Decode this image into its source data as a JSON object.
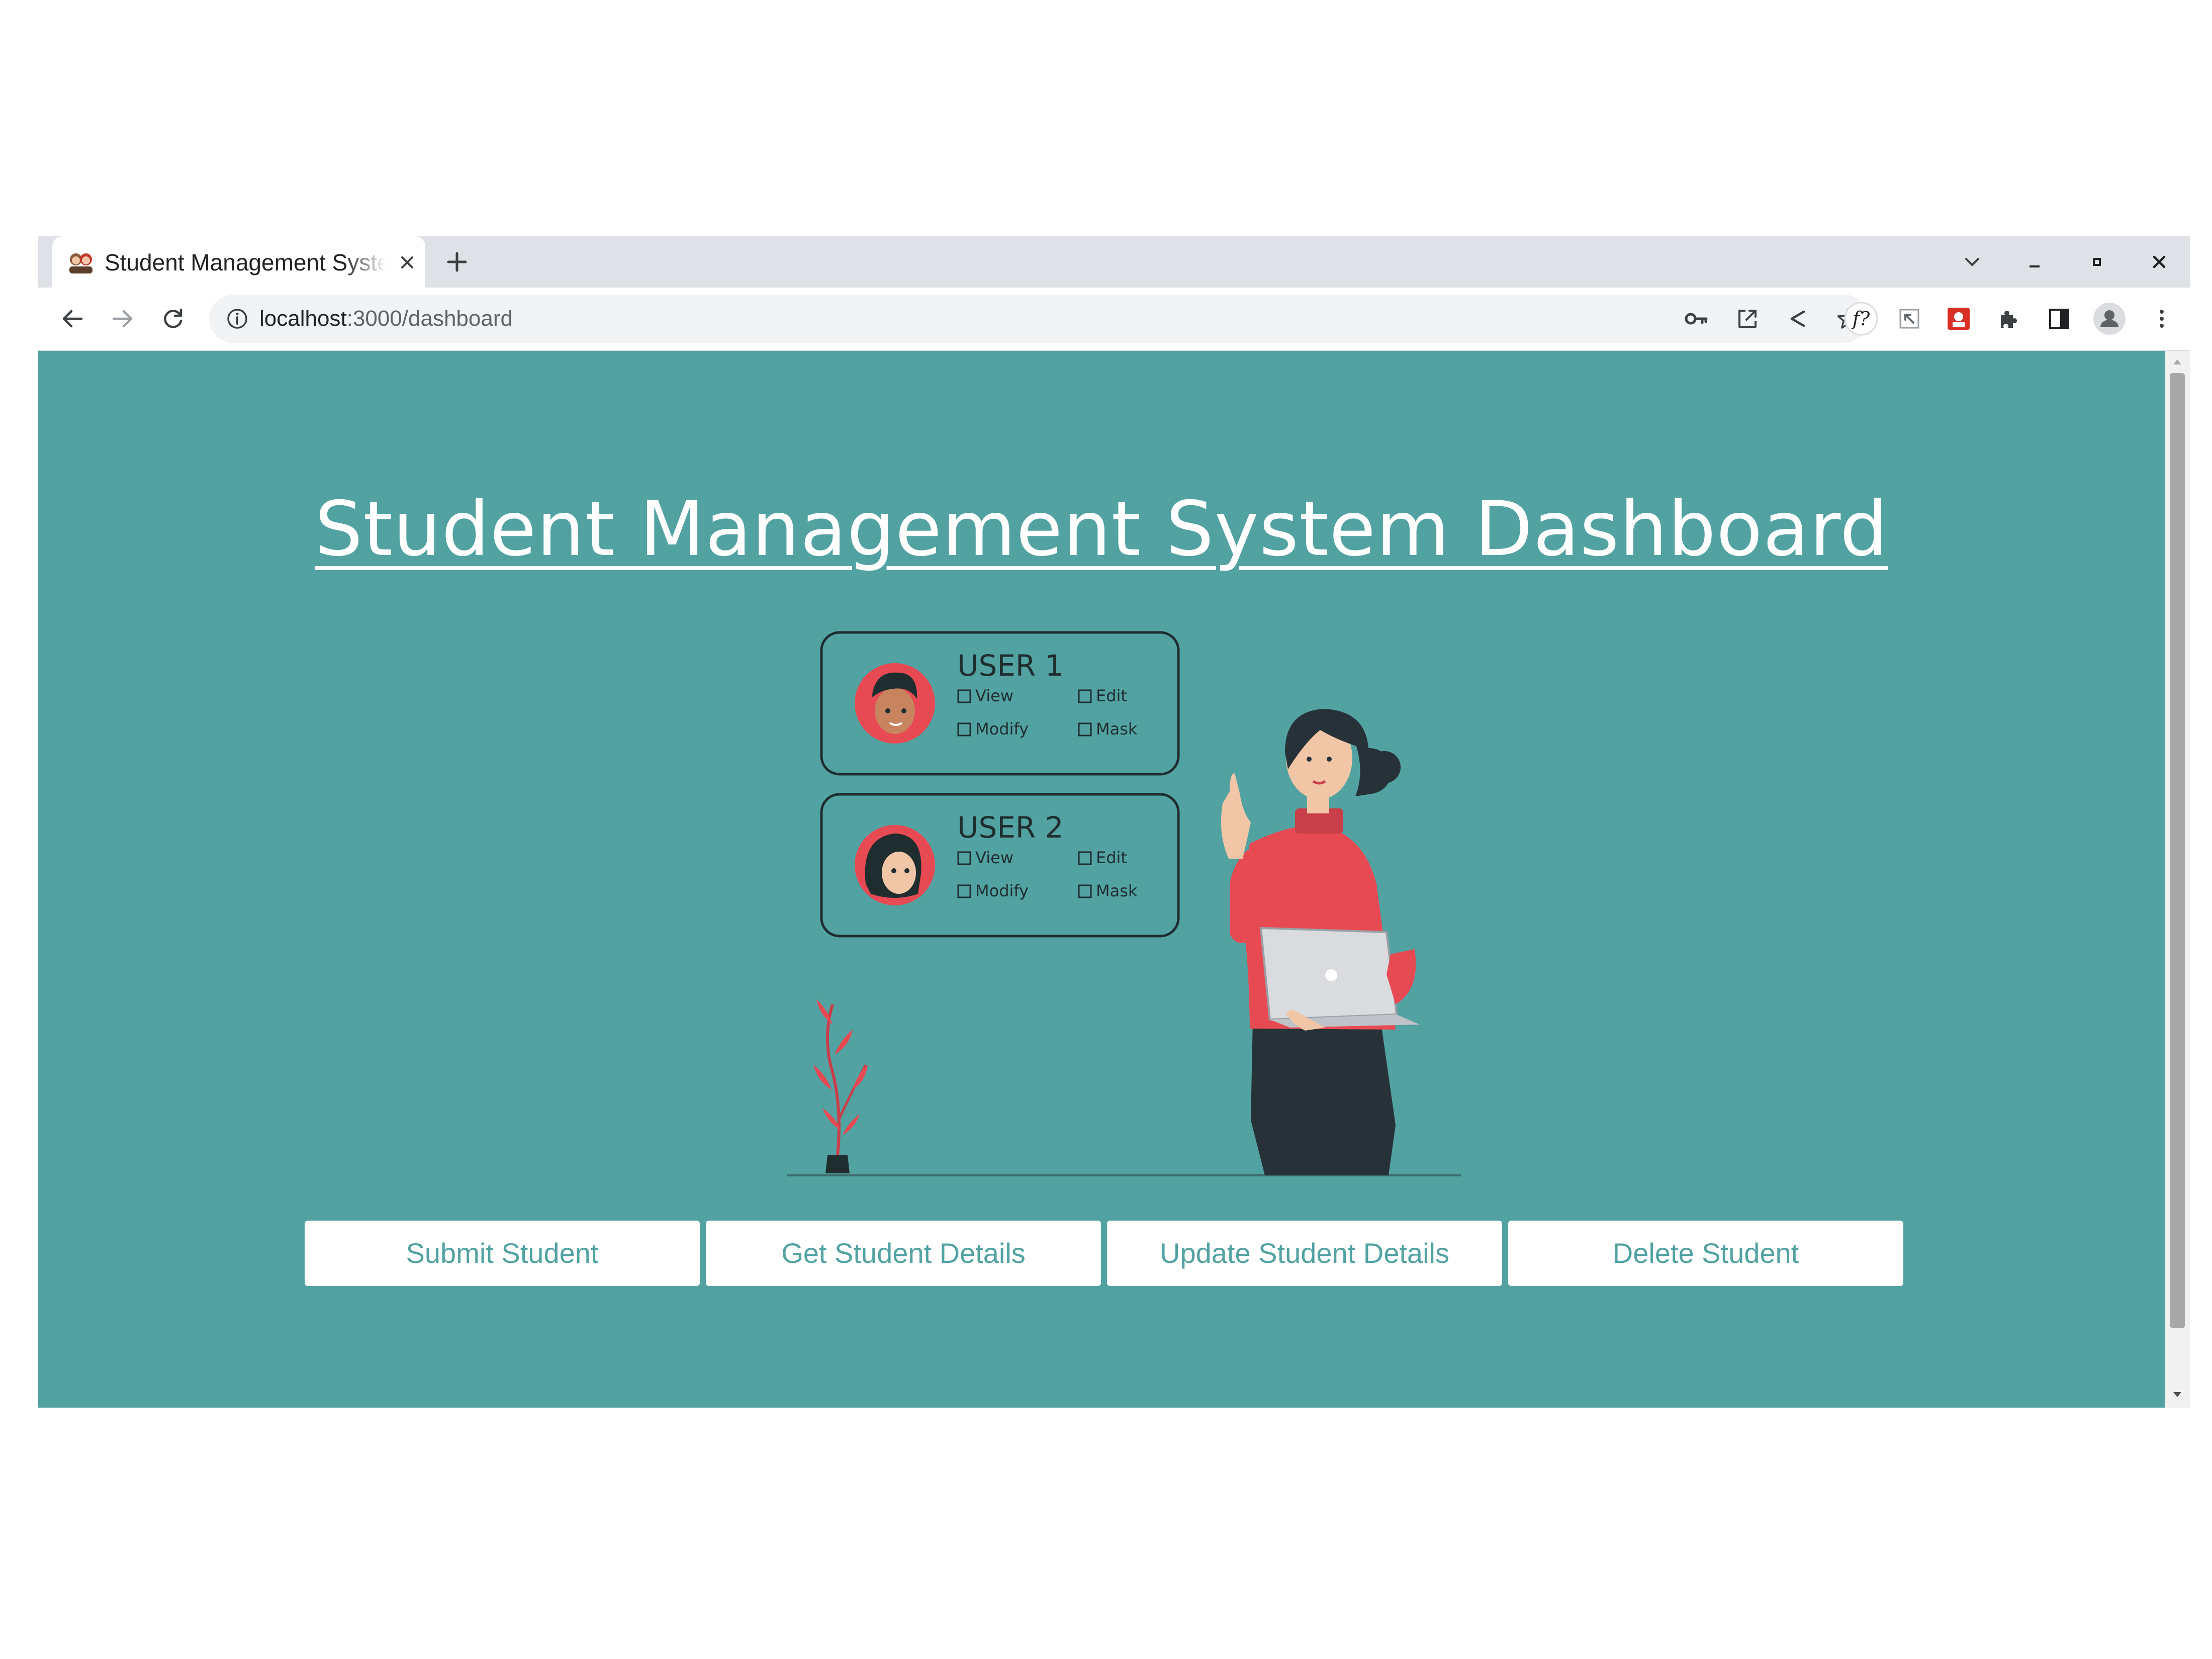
{
  "tab": {
    "title": "Student Management System",
    "new_tab_label": "+"
  },
  "address_bar": {
    "host": "localhost",
    "path": ":3000/dashboard"
  },
  "page": {
    "title": "Student Management System Dashboard",
    "background_color": "#52a2a2",
    "illustration": {
      "cards": [
        {
          "user": "USER 1",
          "permissions": [
            "View",
            "Edit",
            "Modify",
            "Mask"
          ]
        },
        {
          "user": "USER 2",
          "permissions": [
            "View",
            "Edit",
            "Modify",
            "Mask"
          ]
        }
      ]
    },
    "buttons": {
      "submit": "Submit Student",
      "get": "Get Student Details",
      "update": "Update Student Details",
      "delete": "Delete Student"
    }
  },
  "toolbar_icons": [
    "back-arrow-icon",
    "forward-arrow-icon",
    "reload-icon",
    "info-icon",
    "key-icon",
    "open-in-new-icon",
    "share-icon",
    "star-icon",
    "font-finder-icon",
    "cursor-extension-icon",
    "red-extension-icon",
    "puzzle-extensions-icon",
    "side-panel-icon",
    "profile-icon",
    "kebab-menu-icon"
  ]
}
